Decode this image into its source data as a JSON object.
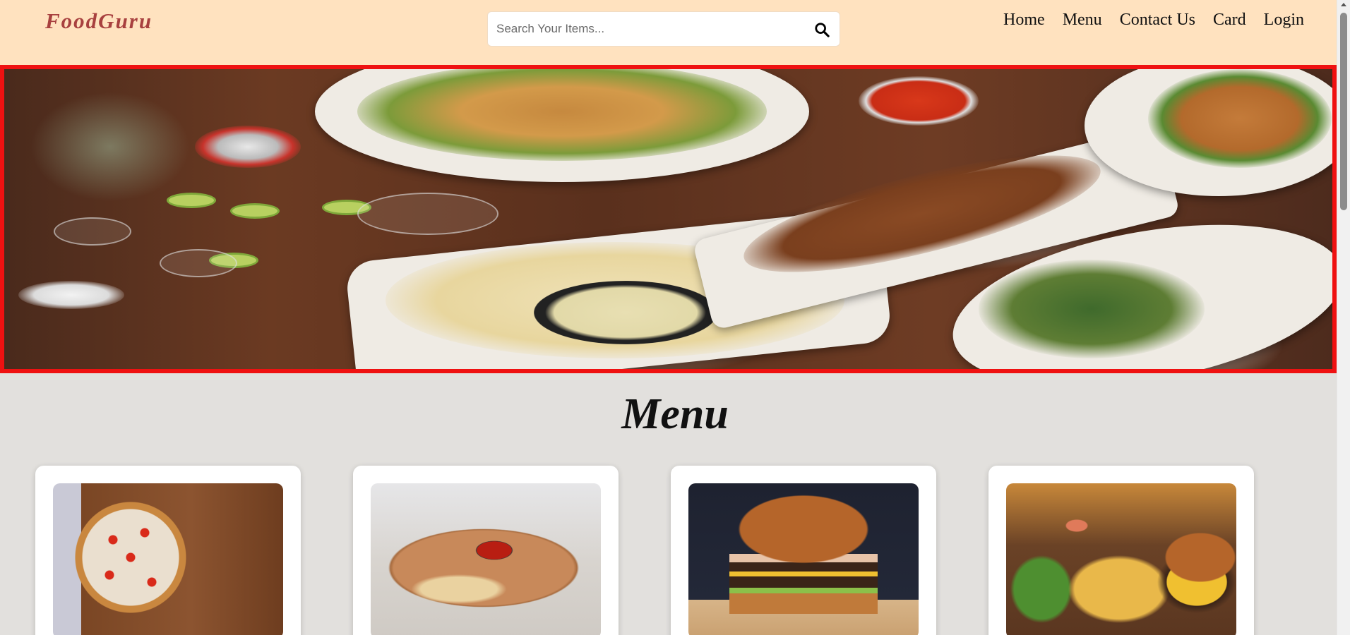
{
  "header": {
    "brand": "FoodGuru",
    "search": {
      "placeholder": "Search Your Items...",
      "icon": "search-icon"
    },
    "nav": [
      {
        "label": "Home"
      },
      {
        "label": "Menu"
      },
      {
        "label": "Contact Us"
      },
      {
        "label": "Card"
      },
      {
        "label": "Login"
      }
    ]
  },
  "hero": {
    "image": "food-spread-hero-image",
    "border_color": "#ef1111"
  },
  "menu": {
    "title": "Menu",
    "items": [
      {
        "image": "pizza-image"
      },
      {
        "image": "spring-rolls-image"
      },
      {
        "image": "burger-image"
      },
      {
        "image": "burger-fries-image"
      }
    ]
  },
  "colors": {
    "header_bg": "#ffe2bf",
    "brand": "#a8403f",
    "page_bg": "#e2e0dd"
  }
}
